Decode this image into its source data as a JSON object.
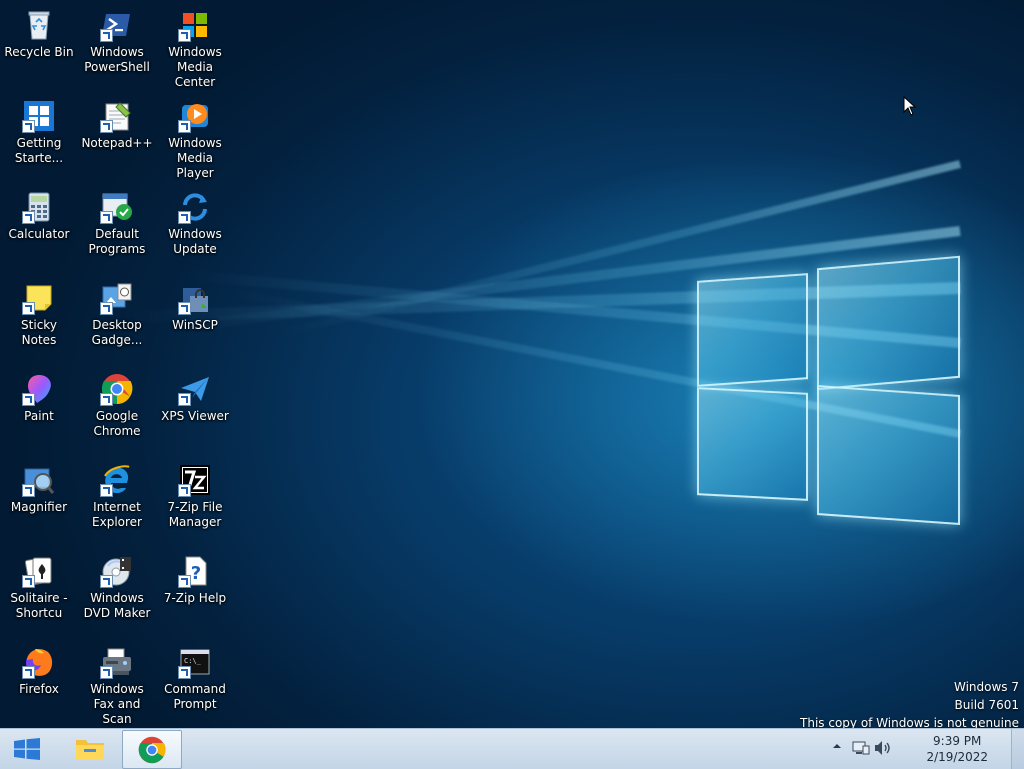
{
  "desktop": {
    "icons": [
      {
        "label": "Recycle Bin",
        "icon": "recycle-bin-icon"
      },
      {
        "label": "Windows PowerShell",
        "icon": "powershell-icon"
      },
      {
        "label": "Windows Media Center",
        "icon": "media-center-icon"
      },
      {
        "label": "Getting Starte...",
        "icon": "getting-started-icon"
      },
      {
        "label": "Notepad++",
        "icon": "notepadpp-icon"
      },
      {
        "label": "Windows Media Player",
        "icon": "media-player-icon"
      },
      {
        "label": "Calculator",
        "icon": "calculator-icon"
      },
      {
        "label": "Default Programs",
        "icon": "default-programs-icon"
      },
      {
        "label": "Windows Update",
        "icon": "windows-update-icon"
      },
      {
        "label": "Sticky Notes",
        "icon": "sticky-notes-icon"
      },
      {
        "label": "Desktop Gadge...",
        "icon": "desktop-gadgets-icon"
      },
      {
        "label": "WinSCP",
        "icon": "winscp-icon"
      },
      {
        "label": "Paint",
        "icon": "paint-icon"
      },
      {
        "label": "Google Chrome",
        "icon": "chrome-icon"
      },
      {
        "label": "XPS Viewer",
        "icon": "xps-viewer-icon"
      },
      {
        "label": "Magnifier",
        "icon": "magnifier-icon"
      },
      {
        "label": "Internet Explorer",
        "icon": "internet-explorer-icon"
      },
      {
        "label": "7-Zip File Manager",
        "icon": "7zip-icon"
      },
      {
        "label": "Solitaire - Shortcu",
        "icon": "solitaire-icon"
      },
      {
        "label": "Windows DVD Maker",
        "icon": "dvd-maker-icon"
      },
      {
        "label": "7-Zip Help",
        "icon": "help-icon"
      },
      {
        "label": "Firefox",
        "icon": "firefox-icon"
      },
      {
        "label": "Windows Fax and Scan",
        "icon": "fax-scan-icon"
      },
      {
        "label": "Command Prompt",
        "icon": "command-prompt-icon"
      }
    ]
  },
  "watermark": {
    "line1": "Windows 7",
    "line2": "Build 7601",
    "line3": "This copy of Windows is not genuine"
  },
  "taskbar": {
    "pinned": [
      {
        "icon": "file-explorer-icon"
      },
      {
        "icon": "chrome-icon",
        "active": true
      }
    ],
    "tray": {
      "icons": [
        "show-hidden-icons-icon",
        "network-icon",
        "volume-icon"
      ]
    },
    "clock": {
      "time": "9:39 PM",
      "date": "2/19/2022"
    }
  },
  "colors": {
    "desktop_bg": "#073a66",
    "taskbar_bg": "#cfdcea",
    "text": "#ffffff"
  }
}
